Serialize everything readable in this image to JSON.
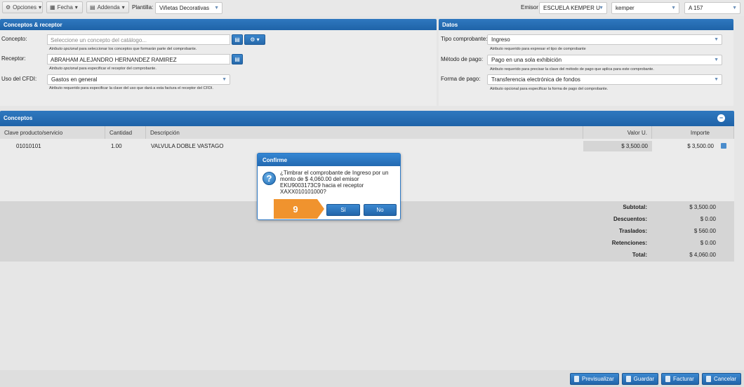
{
  "toolbar": {
    "opciones": "Opciones",
    "fecha": "Fecha",
    "addenda": "Addenda",
    "plantilla_label": "Plantilla:",
    "plantilla_value": "Viñetas Decorativas",
    "emisor_label": "Emisor",
    "emisor_value": "ESCUELA KEMPER U",
    "sucursal_value": "kemper",
    "serie_value": "A 157"
  },
  "conceptos_receptor": {
    "title": "Conceptos & receptor",
    "concepto_label": "Concepto:",
    "concepto_placeholder": "Seleccione un concepto del catálogo...",
    "concepto_hint_prefix": "Atributo opcional",
    "concepto_hint": " para seleccionar los conceptos que formarán parte del comprobante.",
    "receptor_label": "Receptor:",
    "receptor_value": "ABRAHAM ALEJANDRO HERNANDEZ RAMIREZ",
    "receptor_hint_prefix": "Atributo opcional",
    "receptor_hint": " para especificar el receptor del comprobante.",
    "uso_label": "Uso del CFDI:",
    "uso_value": "Gastos en general",
    "uso_hint": "Atributo requerido para especificar la clave del uso que dará a esta factura el receptor del CFDI."
  },
  "datos": {
    "title": "Datos",
    "tipo_label": "Tipo comprobante:",
    "tipo_value": "Ingreso",
    "tipo_hint": "Atributo requerido para expresar el tipo de comprobante",
    "metodo_label": "Método de pago:",
    "metodo_value": "Pago en una sola exhibición",
    "metodo_hint": "Atributo requerido para precisar la clave del método de pago que aplica para este comprobante.",
    "forma_label": "Forma de pago:",
    "forma_value": "Transferencia electrónica de fondos",
    "forma_hint": "Atributo opcional para especificar la forma de pago del comprobante."
  },
  "conceptos": {
    "title": "Conceptos",
    "columns": [
      "Clave producto/servicio",
      "Cantidad",
      "Descripción",
      "Valor U.",
      "Importe"
    ],
    "rows": [
      {
        "clave": "01010101",
        "cantidad": "1.00",
        "descripcion": "VALVULA DOBLE VASTAGO",
        "valor": "$ 3,500.00",
        "importe": "$ 3,500.00"
      }
    ]
  },
  "totales": {
    "subtotal_label": "Subtotal:",
    "subtotal": "$ 3,500.00",
    "descuentos_label": "Descuentos:",
    "descuentos": "$ 0.00",
    "traslados_label": "Traslados:",
    "traslados": "$ 560.00",
    "retenciones_label": "Retenciones:",
    "retenciones": "$ 0.00",
    "total_label": "Total:",
    "total": "$ 4,060.00"
  },
  "dialog": {
    "title": "Confirme",
    "message": "¿Timbrar el comprobante de Ingreso por un monto de $ 4,060.00 del emisor EKU9003173C9 hacia el receptor XAXX010101000?",
    "yes": "Sí",
    "no": "No"
  },
  "step_badge": "9",
  "footer": {
    "previsualizar": "Previsualizar",
    "guardar": "Guardar",
    "facturar": "Facturar",
    "cancelar": "Cancelar"
  },
  "colors": {
    "header_blue": "#2369b0",
    "step_orange": "#f0932e"
  }
}
